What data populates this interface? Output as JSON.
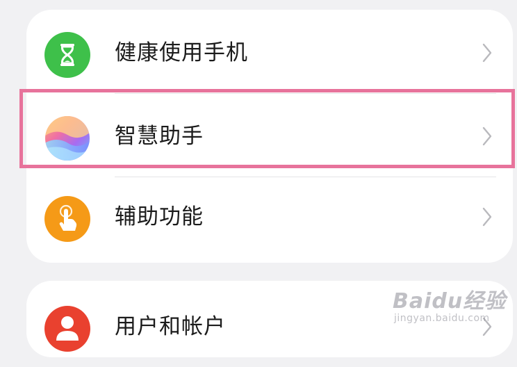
{
  "settings": {
    "items": [
      {
        "label": "健康使用手机",
        "icon": "hourglass-icon",
        "color": "#3ec04a"
      },
      {
        "label": "智慧助手",
        "icon": "gradient-orb-icon",
        "color": "#c98be0"
      },
      {
        "label": "辅助功能",
        "icon": "hand-tap-icon",
        "color": "#f59a17"
      },
      {
        "label": "用户和帐户",
        "icon": "user-icon",
        "color": "#e9412f"
      }
    ]
  },
  "highlight": {
    "color": "#e7739b",
    "target": "智慧助手"
  },
  "watermark": {
    "brand": "Baidu经验",
    "url": "jingyan.baidu.com"
  }
}
